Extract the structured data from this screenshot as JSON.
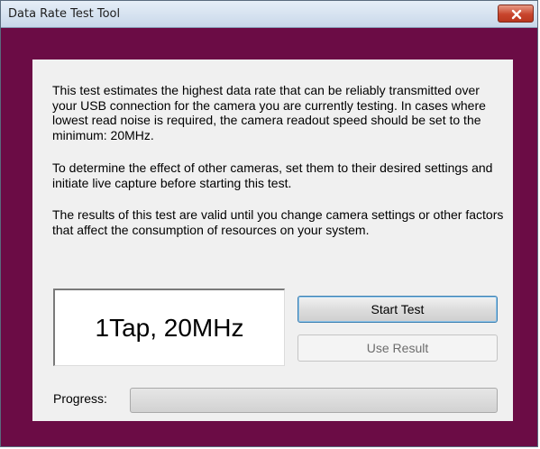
{
  "window": {
    "title": "Data Rate Test Tool"
  },
  "description": {
    "paragraph1": "This test estimates the highest data rate that can be reliably transmitted over your USB connection for the camera you are currently testing.  In cases where lowest read noise is required, the camera readout speed should be set to the minimum: 20MHz.",
    "paragraph2": "To determine the effect of other cameras, set them to their desired settings and initiate live capture before starting this test.",
    "paragraph3": "The results of this test are valid until you change camera settings or other factors that affect the consumption of resources on your system."
  },
  "result_display": {
    "value": "1Tap, 20MHz"
  },
  "buttons": {
    "start_test": "Start Test",
    "use_result": "Use Result"
  },
  "progress": {
    "label": "Progress:",
    "fraction": 0
  },
  "icons": {
    "close": "close-icon"
  },
  "colors": {
    "window_frame": "#6b0c45",
    "panel": "#f0f0f0",
    "close_button": "#c8452d"
  }
}
